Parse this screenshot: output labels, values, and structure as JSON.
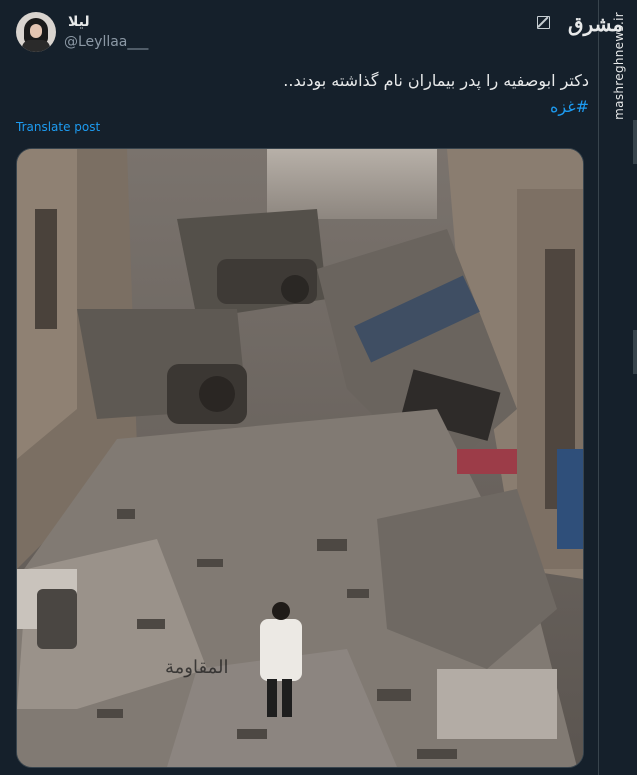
{
  "user": {
    "display_name": "لیلا",
    "handle": "@Leyllaa___"
  },
  "tweet": {
    "text": "دکتر ابوصفیه را پدر بیماران نام گذاشته بودند..",
    "hashtag": "#غزه",
    "translate_label": "Translate post"
  },
  "branding": {
    "logo_text": "مشرق",
    "side_watermark": "mashreghnews.ir"
  },
  "media": {
    "alt_icon": "image",
    "overlay_watermark": "المقاومة"
  },
  "icons": {
    "edit": "edit-icon"
  },
  "colors": {
    "background": "#15202b",
    "accent": "#1d9bf0",
    "text": "#e7e9ea",
    "secondary": "#8b98a5"
  }
}
